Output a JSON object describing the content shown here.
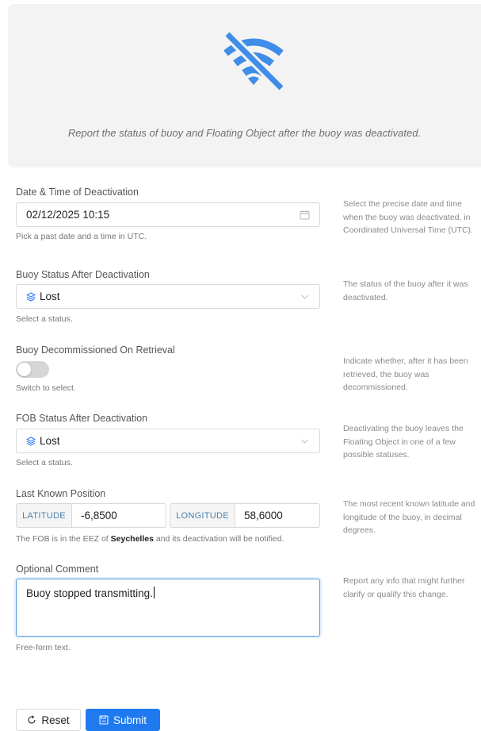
{
  "banner": {
    "icon": "wifi-off-icon",
    "message": "Report the status of buoy and Floating Object after the buoy was deactivated.",
    "accent_color": "#3f8de8"
  },
  "deactivation": {
    "label": "Date & Time of Deactivation",
    "value": "02/12/2025 10:15",
    "help": "Pick a past date and a time in UTC.",
    "side": "Select the precise date and time when the buoy was deactivated, in Coordinated Universal Time (UTC)."
  },
  "buoy_status": {
    "label": "Buoy Status After Deactivation",
    "value": "Lost",
    "help": "Select a status.",
    "side": "The status of the buoy after it was deactivated."
  },
  "decommissioned": {
    "label": "Buoy Decommissioned On Retrieval",
    "checked": false,
    "help": "Switch to select.",
    "side": "Indicate whether, after it has been retrieved, the buoy was decommissioned."
  },
  "fob_status": {
    "label": "FOB Status After Deactivation",
    "value": "Lost",
    "help": "Select a status.",
    "side": "Deactivating the buoy leaves the Floating Object in one of a few possible statuses."
  },
  "position": {
    "label": "Last Known Position",
    "latitude_label": "LATITUDE",
    "latitude": "-6,8500",
    "longitude_label": "LONGITUDE",
    "longitude": "58,6000",
    "help_prefix": "The FOB is in the EEZ of ",
    "help_country": "Seychelles",
    "help_suffix": " and its deactivation will be notified.",
    "side": "The most recent known latitude and longitude of the buoy, in decimal degrees."
  },
  "comment": {
    "label": "Optional Comment",
    "value": "Buoy stopped transmitting.",
    "help": "Free-form text.",
    "side": "Report any info that might further clarify or qualify this change."
  },
  "actions": {
    "reset_label": "Reset",
    "submit_label": "Submit",
    "submit_color": "#1f7af0"
  }
}
